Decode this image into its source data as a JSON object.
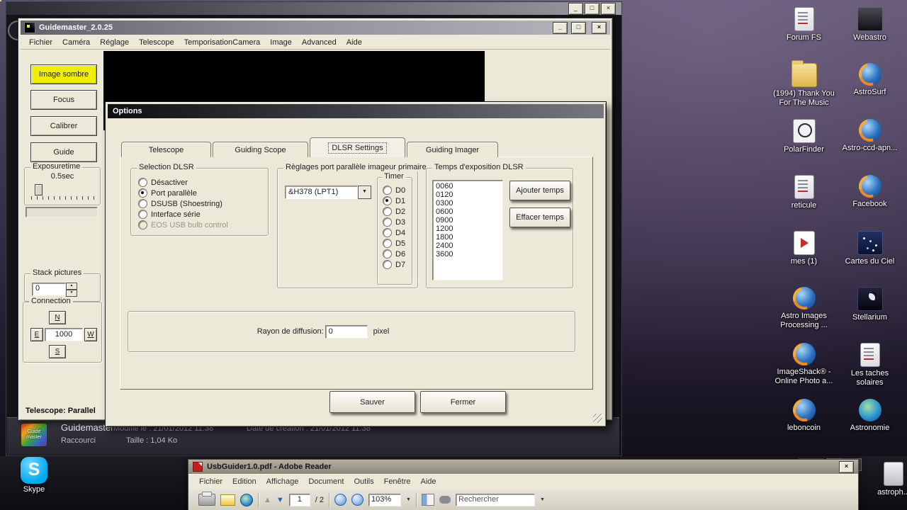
{
  "desktop": {
    "icons": [
      {
        "label": "Forum FS"
      },
      {
        "label": "Webastro"
      },
      {
        "label": "(1994) Thank You For The Music"
      },
      {
        "label": "AstroSurf"
      },
      {
        "label": "PolarFinder"
      },
      {
        "label": "Astro-ccd-apn..."
      },
      {
        "label": "reticule"
      },
      {
        "label": "Facebook"
      },
      {
        "label": "mes (1)"
      },
      {
        "label": "Cartes du Ciel"
      },
      {
        "label": "Astro Images Processing ..."
      },
      {
        "label": "Stellarium"
      },
      {
        "label": "ImageShack® - Online Photo a..."
      },
      {
        "label": "Les taches solaires"
      },
      {
        "label": "leboncoin"
      },
      {
        "label": "Astronomie"
      }
    ],
    "skype_label": "Skype",
    "astroph_label": "astroph..."
  },
  "guidemaster": {
    "title": "Guidemaster_2.0.25",
    "menu": [
      "Fichier",
      "Caméra",
      "Réglage",
      "Telescope",
      "TemporisationCamera",
      "Image",
      "Advanced",
      "Aide"
    ],
    "side_buttons": [
      "Image sombre",
      "Focus",
      "Calibrer",
      "Guide"
    ],
    "exposure": {
      "label": "Exposuretime",
      "value": "0.5sec"
    },
    "stack": {
      "label": "Stack pictures",
      "value": "0"
    },
    "connection": {
      "label": "Connection",
      "north": "N",
      "east": "E",
      "south": "S",
      "west": "W",
      "value": "1000"
    },
    "status": "Telescope: Parallel"
  },
  "options": {
    "title": "Options",
    "tabs": [
      "Telescope",
      "Guiding Scope",
      "DLSR Settings",
      "Guiding Imager"
    ],
    "active_tab": "DLSR Settings",
    "selection_group": {
      "label": "Selection DLSR",
      "items": [
        {
          "label": "Désactiver",
          "selected": false
        },
        {
          "label": "Port parallèle",
          "selected": true
        },
        {
          "label": "DSUSB (Shoestring)",
          "selected": false
        },
        {
          "label": "Interface série",
          "selected": false
        },
        {
          "label": "EOS USB bulb control",
          "selected": false,
          "disabled": true
        }
      ]
    },
    "port_group": {
      "label": "Règlages port parallèle imageur primaire",
      "combo_value": "&H378 (LPT1)",
      "timer": {
        "label": "Timer",
        "items": [
          "D0",
          "D1",
          "D2",
          "D3",
          "D4",
          "D5",
          "D6",
          "D7"
        ],
        "selected": "D1"
      }
    },
    "times_group": {
      "label": "Temps d'exposition DLSR",
      "times": [
        "0060",
        "0120",
        "0300",
        "0600",
        "0900",
        "1200",
        "1800",
        "2400",
        "3600"
      ],
      "add_label": "Ajouter temps",
      "clear_label": "Effacer temps"
    },
    "diffusion": {
      "label": "Rayon de diffusion:",
      "value": "0",
      "unit": "pixel"
    },
    "save_label": "Sauver",
    "close_label": "Fermer"
  },
  "file_details": {
    "icon_text_1": "Guide",
    "icon_text_2": "master",
    "name": "Guidemaster",
    "modified": "Modifié le : 21/01/2012 11:38",
    "created": "Date de création : 21/01/2012 11:38",
    "type": "Raccourci",
    "size": "Taille : 1,04 Ko"
  },
  "adobe": {
    "title": "UsbGuider1.0.pdf - Adobe Reader",
    "menu": [
      "Fichier",
      "Edition",
      "Affichage",
      "Document",
      "Outils",
      "Fenêtre",
      "Aide"
    ],
    "page_value": "1",
    "page_total": "/ 2",
    "zoom_value": "103%",
    "search_text": "Rechercher"
  }
}
